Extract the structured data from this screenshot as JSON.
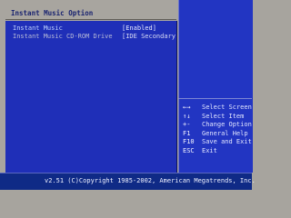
{
  "page": {
    "title": "Instant Music Option"
  },
  "settings": [
    {
      "label": "Instant Music",
      "value": "[Enabled]"
    },
    {
      "label": "Instant Music CD-ROM Drive",
      "value": "[IDE Secondary M]"
    }
  ],
  "help_keys": [
    {
      "key": "←→",
      "description": "Select Screen"
    },
    {
      "key": "↑↓",
      "description": "Select Item"
    },
    {
      "key": "+-",
      "description": "Change Option"
    },
    {
      "key": "F1",
      "description": "General Help"
    },
    {
      "key": "F10",
      "description": "Save and Exit"
    },
    {
      "key": "ESC",
      "description": "Exit"
    }
  ],
  "footer": {
    "text": "v2.51 (C)Copyright 1985-2002, American Megatrends, Inc."
  },
  "colors": {
    "main_panel": "#1f2fb8",
    "help_panel": "#2235c2",
    "status_bar": "#0f2a86",
    "title_text": "#1a2470"
  }
}
